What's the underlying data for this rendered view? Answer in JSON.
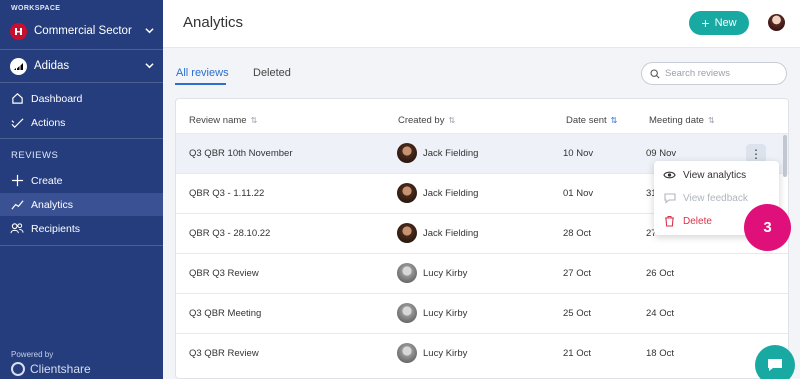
{
  "sidebar": {
    "workspace_label": "WORKSPACE",
    "workspace": "Commercial Sector",
    "account": "Adidas",
    "nav": [
      {
        "label": "Dashboard"
      },
      {
        "label": "Actions"
      }
    ],
    "section_label": "REVIEWS",
    "reviews_nav": [
      {
        "label": "Create"
      },
      {
        "label": "Analytics"
      },
      {
        "label": "Recipients"
      }
    ],
    "powered_by": "Powered by",
    "brand": "Clientshare"
  },
  "header": {
    "title": "Analytics",
    "new_label": "New"
  },
  "tabs": {
    "all": "All reviews",
    "deleted": "Deleted"
  },
  "search": {
    "placeholder": "Search reviews"
  },
  "table": {
    "headers": {
      "name": "Review name",
      "creator": "Created by",
      "sent": "Date sent",
      "meeting": "Meeting date"
    },
    "rows": [
      {
        "name": "Q3 QBR 10th November",
        "creator": "Jack Fielding",
        "sent": "10 Nov",
        "meeting": "09 Nov"
      },
      {
        "name": "QBR Q3 - 1.11.22",
        "creator": "Jack Fielding",
        "sent": "01 Nov",
        "meeting": "31"
      },
      {
        "name": "QBR Q3 - 28.10.22",
        "creator": "Jack Fielding",
        "sent": "28 Oct",
        "meeting": "27"
      },
      {
        "name": "QBR Q3 Review",
        "creator": "Lucy Kirby",
        "sent": "27 Oct",
        "meeting": "26 Oct"
      },
      {
        "name": "Q3 QBR Meeting",
        "creator": "Lucy Kirby",
        "sent": "25 Oct",
        "meeting": "24 Oct"
      },
      {
        "name": "Q3 QBR Review",
        "creator": "Lucy Kirby",
        "sent": "21 Oct",
        "meeting": "18 Oct"
      }
    ]
  },
  "menu": {
    "view": "View analytics",
    "feedback": "View feedback",
    "delete": "Delete"
  },
  "badge": "3",
  "colors": {
    "sidebar": "#253d7d",
    "accent": "#19a9a3",
    "link": "#2b6fd1",
    "danger": "#d9334a",
    "badge": "#e0107a"
  }
}
